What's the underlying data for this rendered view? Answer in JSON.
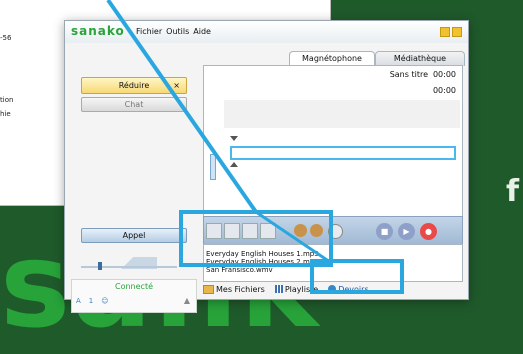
{
  "background": {
    "doc_fragments": [
      "-56",
      "tion",
      "hie"
    ],
    "big_text": "sank",
    "small_letter": "f"
  },
  "window": {
    "logo": "sanako",
    "menu": [
      "Fichier",
      "Outils",
      "Aide"
    ]
  },
  "left_panel": {
    "reduire_label": "Réduire",
    "reduire_close": "×",
    "chat_label": "Chat",
    "appel_label": "Appel",
    "volume_level": 0.18,
    "status_label": "Connecté",
    "status_row": [
      "A",
      "1"
    ]
  },
  "tabs": [
    "Magnétophone",
    "Médiathèque"
  ],
  "recorder": {
    "title": "Sans titre",
    "time1": "00:00",
    "time2": "00:00"
  },
  "files": [
    "Everyday English Houses 1.mp3",
    "Everyday English Houses 2.mp3",
    "San Fransisco.wmv"
  ],
  "bottom": {
    "mes_fichiers": "Mes Fichiers",
    "playlist": "Playliste",
    "devoirs": "Devoirs"
  },
  "colors": {
    "highlight": "#2aa7df",
    "brand_green": "#2aa43a",
    "record_red": "#e84a4a"
  }
}
